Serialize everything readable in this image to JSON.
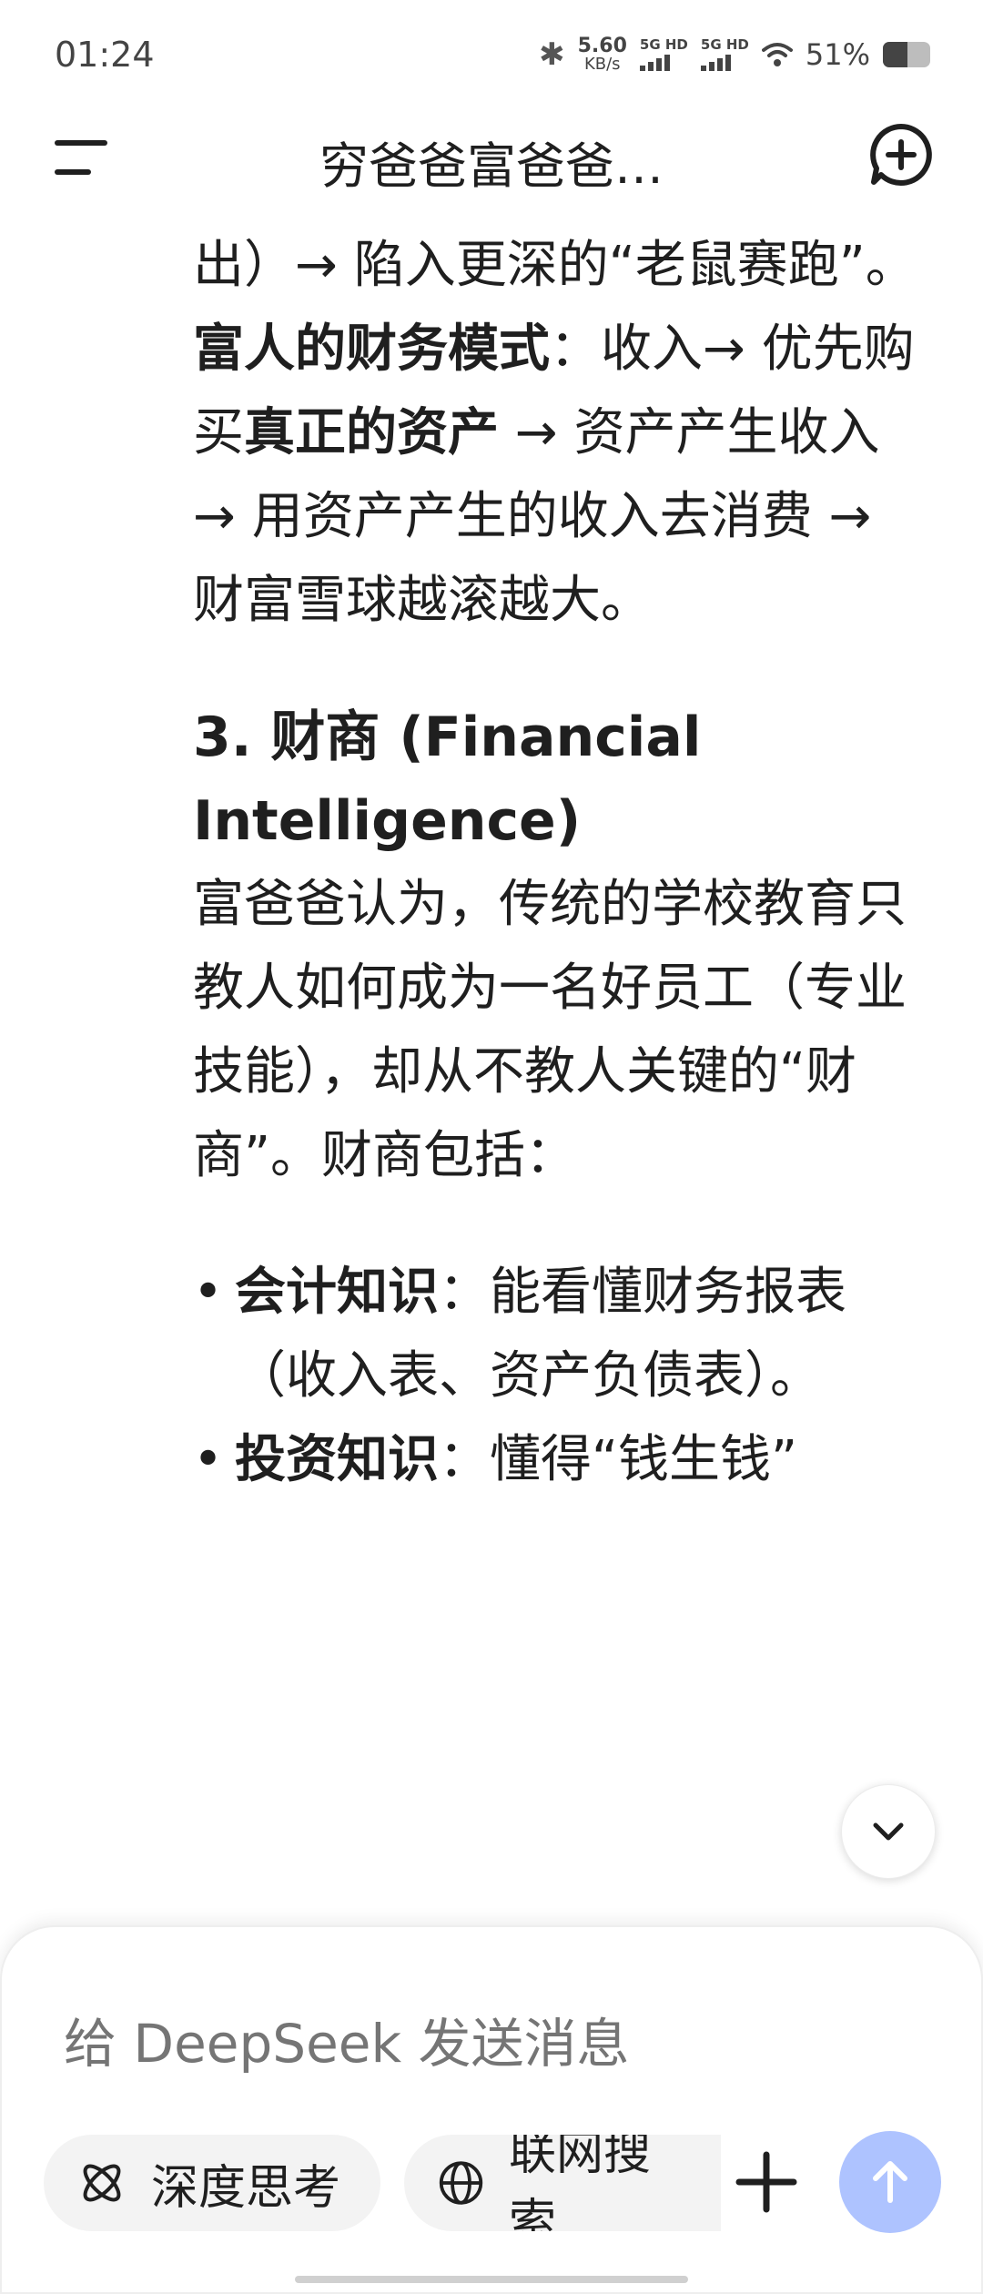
{
  "status_bar": {
    "time": "01:24",
    "net_speed_value": "5.60",
    "net_speed_unit": "KB/s",
    "sim1_label": "5G HD",
    "sim2_label": "5G HD",
    "battery_percent": "51%",
    "battery_level": 0.51
  },
  "header": {
    "title": "穷爸爸富爸爸…"
  },
  "content": {
    "line1": "出）→ 陷入更深的“老鼠赛跑”。",
    "rich_label": "富人的财务模式",
    "rich_text_a": "：收入→ 优先购买",
    "rich_bold": "真正的资产",
    "rich_text_b": " → 资产产生收入 → 用资产产生的收入去消费 → 财富雪球越滚越大。",
    "section_heading": "3. 财商 (Financial Intelligence)",
    "section_paragraph": "富爸爸认为，传统的学校教育只教人如何成为一名好员工（专业技能），却从不教人关键的“财商”。财商包括：",
    "bullets": [
      {
        "label": "会计知识",
        "text": "：能看懂财务报表（收入表、资产负债表）。"
      },
      {
        "label": "投资知识",
        "text": "：懂得“钱生钱”"
      }
    ]
  },
  "composer": {
    "placeholder": "给 DeepSeek 发送消息",
    "deep_think_label": "深度思考",
    "web_search_label": "联网搜索"
  },
  "colors": {
    "send_button": "#aec3ff",
    "pill_bg": "#f3f3f3",
    "text": "#1f1f1f"
  },
  "icons": {
    "menu": "menu-icon",
    "new_chat": "new-chat-icon",
    "scroll_down": "chevron-down-icon",
    "deep_think": "atom-icon",
    "web_search": "globe-icon",
    "plus": "plus-icon",
    "send": "arrow-up-icon"
  }
}
